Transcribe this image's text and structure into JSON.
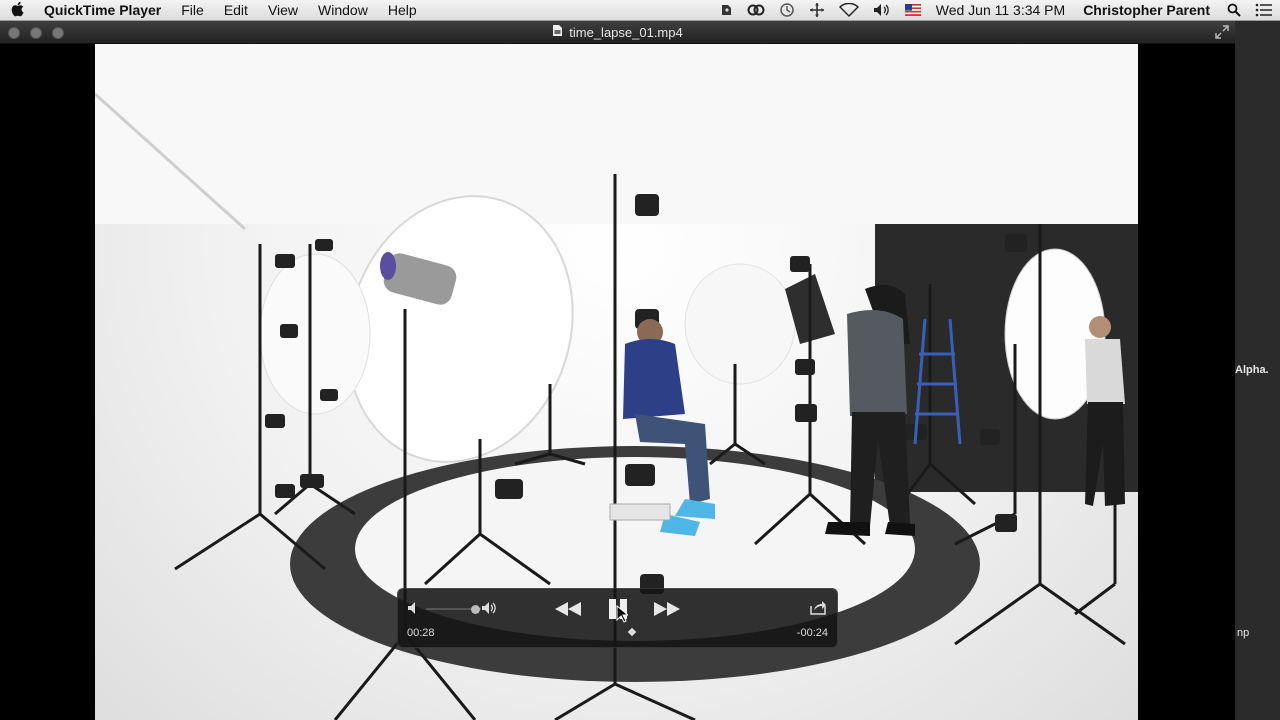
{
  "menubar": {
    "apple_icon": "apple-logo-icon",
    "app_name": "QuickTime Player",
    "menus": [
      "File",
      "Edit",
      "View",
      "Window",
      "Help"
    ],
    "status_icons": [
      "evernote-icon",
      "creative-cloud-icon",
      "time-machine-icon",
      "move-icon",
      "wifi-icon",
      "volume-icon",
      "us-flag-icon"
    ],
    "clock": "Wed Jun 11  3:34 PM",
    "user": "Christopher Parent",
    "right_icons": [
      "spotlight-search-icon",
      "notification-center-icon"
    ]
  },
  "window": {
    "title": "time_lapse_01.mp4",
    "file_icon": "movie-file-icon"
  },
  "controller": {
    "elapsed": "00:28",
    "remaining": "-00:24",
    "progress_fraction": 0.54,
    "volume_fraction": 0.9,
    "buttons": {
      "mute": "volume-low-icon",
      "volume_max": "volume-high-icon",
      "rewind": "rewind-icon",
      "play_pause": "pause-icon",
      "fast_forward": "fast-forward-icon",
      "share": "share-icon"
    }
  },
  "desktop": {
    "label_1": "Alpha.",
    "label_2": "np"
  },
  "colors": {
    "menubar_bg": "#e8e8e8",
    "window_chrome": "#2e2e2e",
    "hud_bg": "#141414",
    "floor_ring": "#3c3c3c"
  }
}
